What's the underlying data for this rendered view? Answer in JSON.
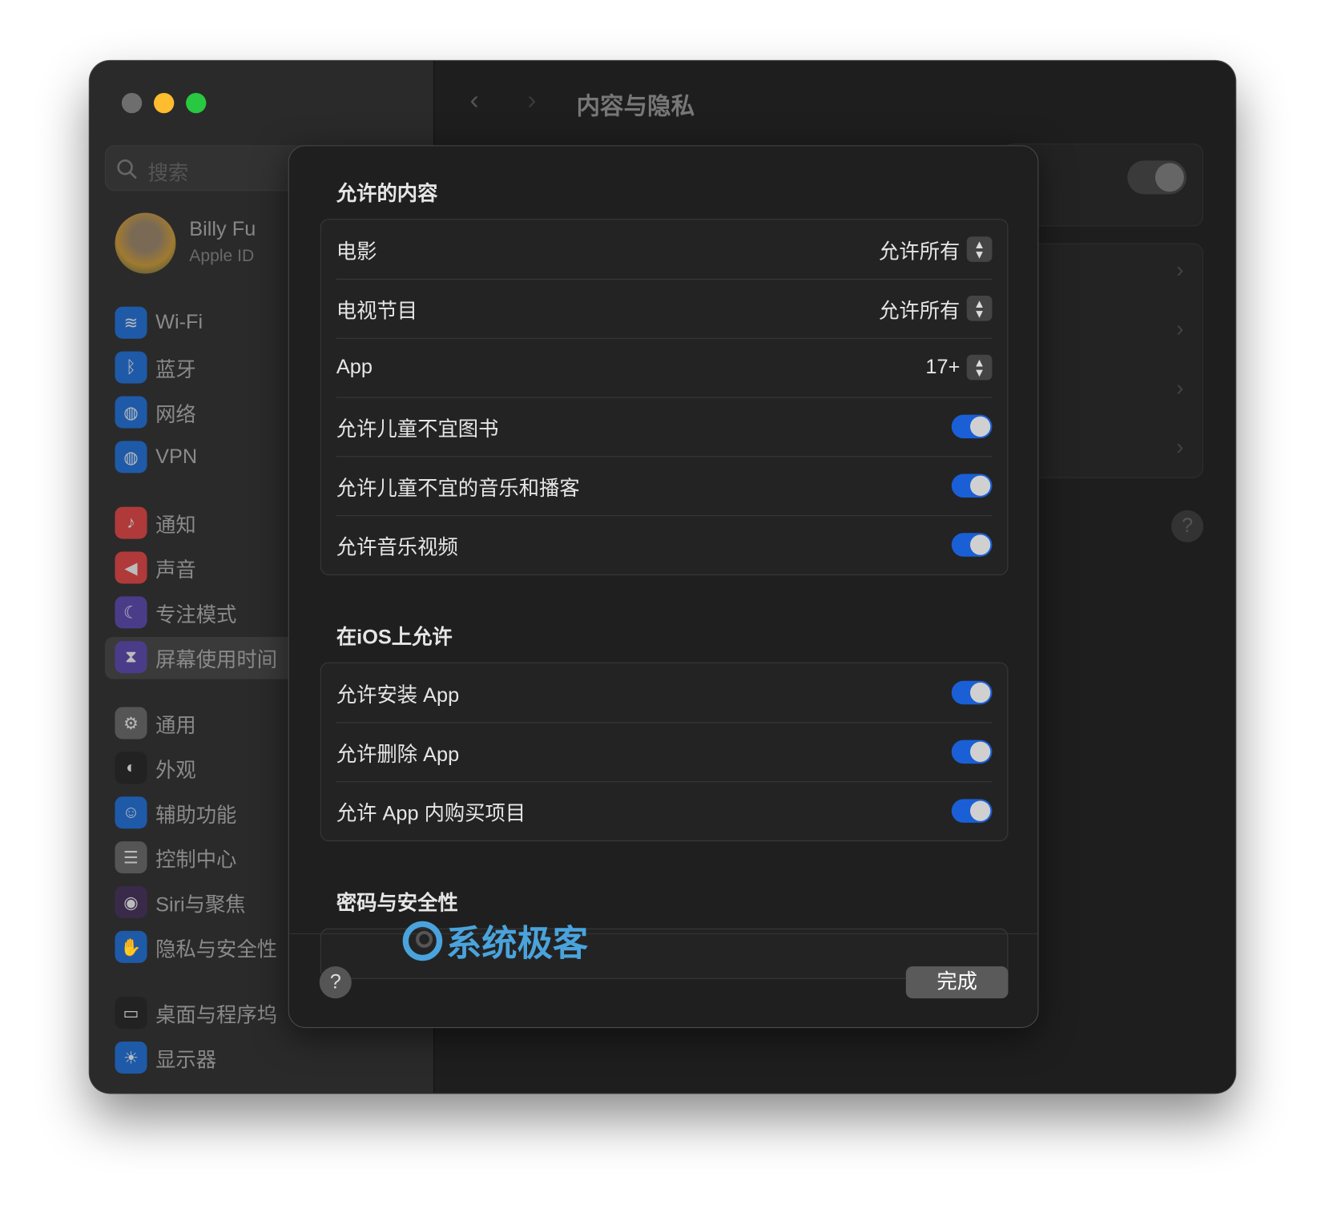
{
  "window": {
    "title": "内容与隐私",
    "colors": {
      "close": "#6e6e6e",
      "minimize": "#febc2e",
      "zoom": "#28c840",
      "accent": "#1a5fd6",
      "highlight": "#57ade3"
    }
  },
  "sidebar": {
    "search_placeholder": "搜索",
    "user": {
      "name": "Billy Fu",
      "subtitle": "Apple ID"
    },
    "items": [
      {
        "label": "Wi-Fi",
        "icon": "wifi-icon"
      },
      {
        "label": "蓝牙",
        "icon": "bluetooth-icon"
      },
      {
        "label": "网络",
        "icon": "globe-icon"
      },
      {
        "label": "VPN",
        "icon": "vpn-icon"
      },
      {
        "label": "通知",
        "icon": "bell-icon"
      },
      {
        "label": "声音",
        "icon": "speaker-icon"
      },
      {
        "label": "专注模式",
        "icon": "moon-icon"
      },
      {
        "label": "屏幕使用时间",
        "icon": "hourglass-icon",
        "selected": true
      },
      {
        "label": "通用",
        "icon": "gear-icon"
      },
      {
        "label": "外观",
        "icon": "appearance-icon"
      },
      {
        "label": "辅助功能",
        "icon": "accessibility-icon"
      },
      {
        "label": "控制中心",
        "icon": "control-center-icon"
      },
      {
        "label": "Siri与聚焦",
        "icon": "siri-icon"
      },
      {
        "label": "隐私与安全性",
        "icon": "hand-icon"
      },
      {
        "label": "桌面与程序坞",
        "icon": "dock-icon"
      },
      {
        "label": "显示器",
        "icon": "sun-icon"
      }
    ]
  },
  "modal": {
    "sections": [
      {
        "title": "允许的内容",
        "rows": [
          {
            "label": "电影",
            "value": "允许所有",
            "type": "popup"
          },
          {
            "label": "电视节目",
            "value": "允许所有",
            "type": "popup"
          },
          {
            "label": "App",
            "value": "17+",
            "type": "popup"
          },
          {
            "label": "允许儿童不宜图书",
            "type": "toggle",
            "on": true
          },
          {
            "label": "允许儿童不宜的音乐和播客",
            "type": "toggle",
            "on": true
          },
          {
            "label": "允许音乐视频",
            "type": "toggle",
            "on": true
          }
        ]
      },
      {
        "title": "在iOS上允许",
        "rows": [
          {
            "label": "允许安装 App",
            "type": "toggle",
            "on": true
          },
          {
            "label": "允许删除 App",
            "type": "toggle",
            "on": true
          },
          {
            "label": "允许 App 内购买项目",
            "type": "toggle",
            "on": true
          }
        ]
      },
      {
        "title": "密码与安全性"
      }
    ],
    "help_label": "?",
    "done_label": "完成"
  },
  "background_help": "?",
  "watermark": "系统极客"
}
